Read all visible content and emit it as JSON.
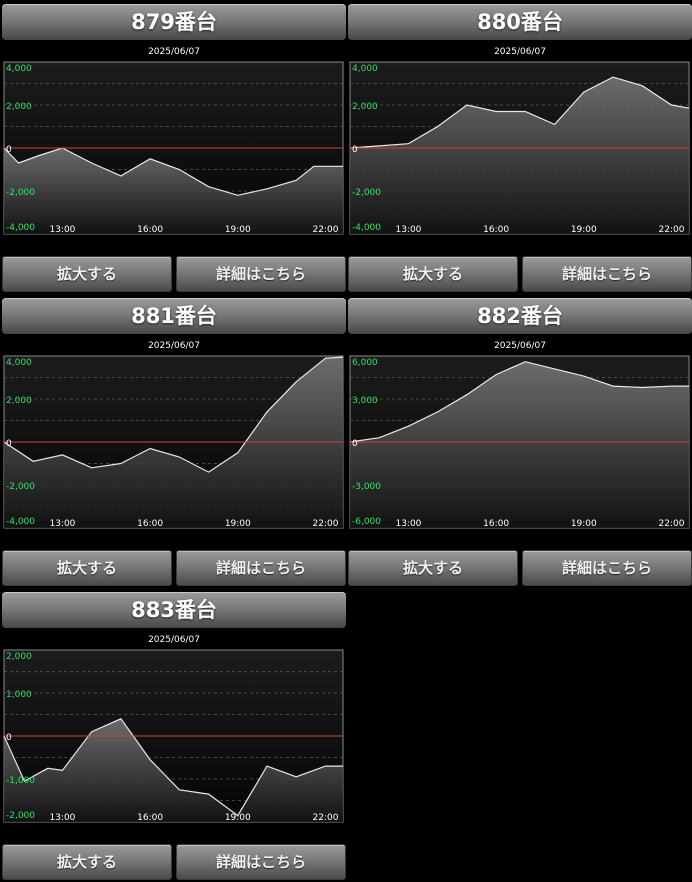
{
  "buttons": {
    "zoom": "拡大する",
    "detail": "詳細はこちら"
  },
  "colors": {
    "zero_line": "#d83a3a",
    "y_label": "#2fe06a",
    "zero_label": "#ffffff",
    "line": "#e8e8e8",
    "grid": "#5a5a5a"
  },
  "chart_data": [
    {
      "type": "area",
      "title": "879番台",
      "subtitle": "2025/06/07",
      "x_ticks": [
        "13:00",
        "16:00",
        "19:00",
        "22:00"
      ],
      "y_ticks": [
        "4,000",
        "2,000",
        "0",
        "-2,000",
        "-4,000"
      ],
      "ylim": [
        -4000,
        4000
      ],
      "grid": "dashed horizontal",
      "x_hours": [
        11,
        11.5,
        12.2,
        13,
        14,
        15,
        16,
        17,
        18,
        19,
        20,
        21,
        21.6,
        22.6
      ],
      "values": [
        0,
        -700,
        -350,
        0,
        -700,
        -1300,
        -500,
        -1000,
        -1800,
        -2200,
        -1900,
        -1500,
        -850,
        -850
      ]
    },
    {
      "type": "area",
      "title": "880番台",
      "subtitle": "2025/06/07",
      "x_ticks": [
        "13:00",
        "16:00",
        "19:00",
        "22:00"
      ],
      "y_ticks": [
        "4,000",
        "2,000",
        "0",
        "-2,000",
        "-4,000"
      ],
      "ylim": [
        -4000,
        4000
      ],
      "grid": "dashed horizontal",
      "x_hours": [
        11,
        12,
        13,
        14,
        15,
        16,
        17,
        18,
        19,
        20,
        21,
        22,
        22.6
      ],
      "values": [
        0,
        100,
        200,
        1000,
        2000,
        1700,
        1700,
        1100,
        2600,
        3300,
        2900,
        2000,
        1850,
        1850
      ]
    },
    {
      "type": "area",
      "title": "881番台",
      "subtitle": "2025/06/07",
      "x_ticks": [
        "13:00",
        "16:00",
        "19:00",
        "22:00"
      ],
      "y_ticks": [
        "4,000",
        "2,000",
        "0",
        "-2,000",
        "-4,000"
      ],
      "ylim": [
        -4000,
        4000
      ],
      "grid": "dashed horizontal",
      "x_hours": [
        11,
        12,
        13,
        14,
        15,
        16,
        17,
        18,
        19,
        20,
        21,
        22,
        22.6
      ],
      "values": [
        0,
        -900,
        -600,
        -1200,
        -1000,
        -300,
        -700,
        -1400,
        -500,
        1400,
        2800,
        3900,
        3950,
        3950
      ]
    },
    {
      "type": "area",
      "title": "882番台",
      "subtitle": "2025/06/07",
      "x_ticks": [
        "13:00",
        "16:00",
        "19:00",
        "22:00"
      ],
      "y_ticks": [
        "6,000",
        "3,000",
        "0",
        "-3,000",
        "-6,000"
      ],
      "ylim": [
        -6000,
        6000
      ],
      "grid": "dashed horizontal",
      "x_hours": [
        11,
        12,
        13,
        14,
        15,
        16,
        17,
        18,
        19,
        20,
        21,
        22,
        22.6
      ],
      "values": [
        0,
        300,
        1100,
        2100,
        3300,
        4700,
        5600,
        5100,
        4600,
        3900,
        3800,
        3900,
        3900,
        3900
      ]
    },
    {
      "type": "area",
      "title": "883番台",
      "subtitle": "2025/06/07",
      "x_ticks": [
        "13:00",
        "16:00",
        "19:00",
        "22:00"
      ],
      "y_ticks": [
        "2,000",
        "1,000",
        "0",
        "-1,000",
        "-2,000"
      ],
      "ylim": [
        -2000,
        2000
      ],
      "grid": "dashed horizontal",
      "x_hours": [
        11,
        11.7,
        12.5,
        13,
        14,
        15,
        16,
        17,
        18,
        19,
        20,
        21,
        22,
        22.6
      ],
      "values": [
        0,
        -1050,
        -750,
        -800,
        100,
        400,
        -550,
        -1250,
        -1350,
        -1850,
        -700,
        -950,
        -700,
        -700
      ]
    }
  ]
}
